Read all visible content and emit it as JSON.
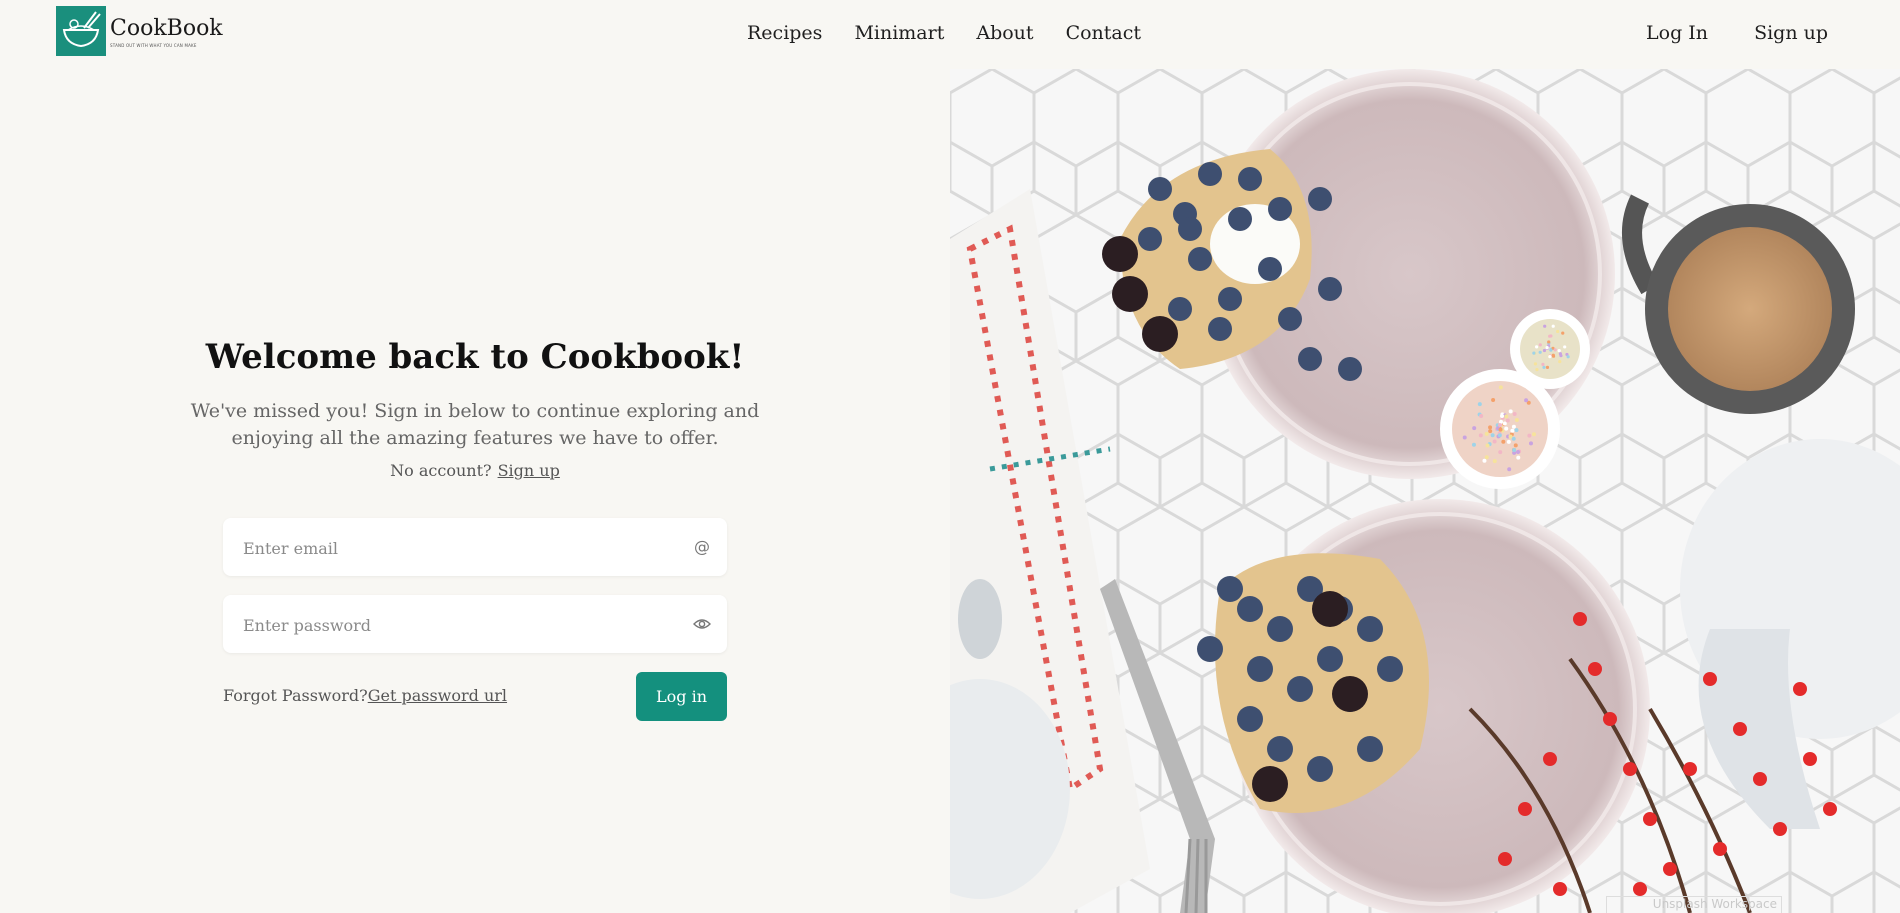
{
  "brand": {
    "name": "CookBook",
    "tagline": "STAND OUT WITH WHAT YOU CAN MAKE",
    "color": "#1a8f7d"
  },
  "nav": {
    "items": [
      {
        "label": "Recipes"
      },
      {
        "label": "Minimart"
      },
      {
        "label": "About"
      },
      {
        "label": "Contact"
      }
    ],
    "login_label": "Log In",
    "signup_label": "Sign up"
  },
  "login": {
    "title": "Welcome back to Cookbook!",
    "subtitle": "We've missed you! Sign in below to continue exploring and enjoying all the amazing features we have to offer.",
    "no_account_text": "No account?",
    "signup_link": "Sign up",
    "email_placeholder": "Enter email",
    "email_icon": "at-icon",
    "password_placeholder": "Enter password",
    "password_icon": "eye-icon",
    "forgot_text": "Forgot Password?",
    "forgot_link": "Get password url",
    "submit_label": "Log in",
    "accent": "#14907e"
  },
  "hero_image": {
    "description": "Top-down photo of waffles with blueberries and blackberries on pink plates, coffee pitcher, sprinkles and red berries on white hexagon tiles",
    "watermark": "Unsplash Workspace"
  }
}
